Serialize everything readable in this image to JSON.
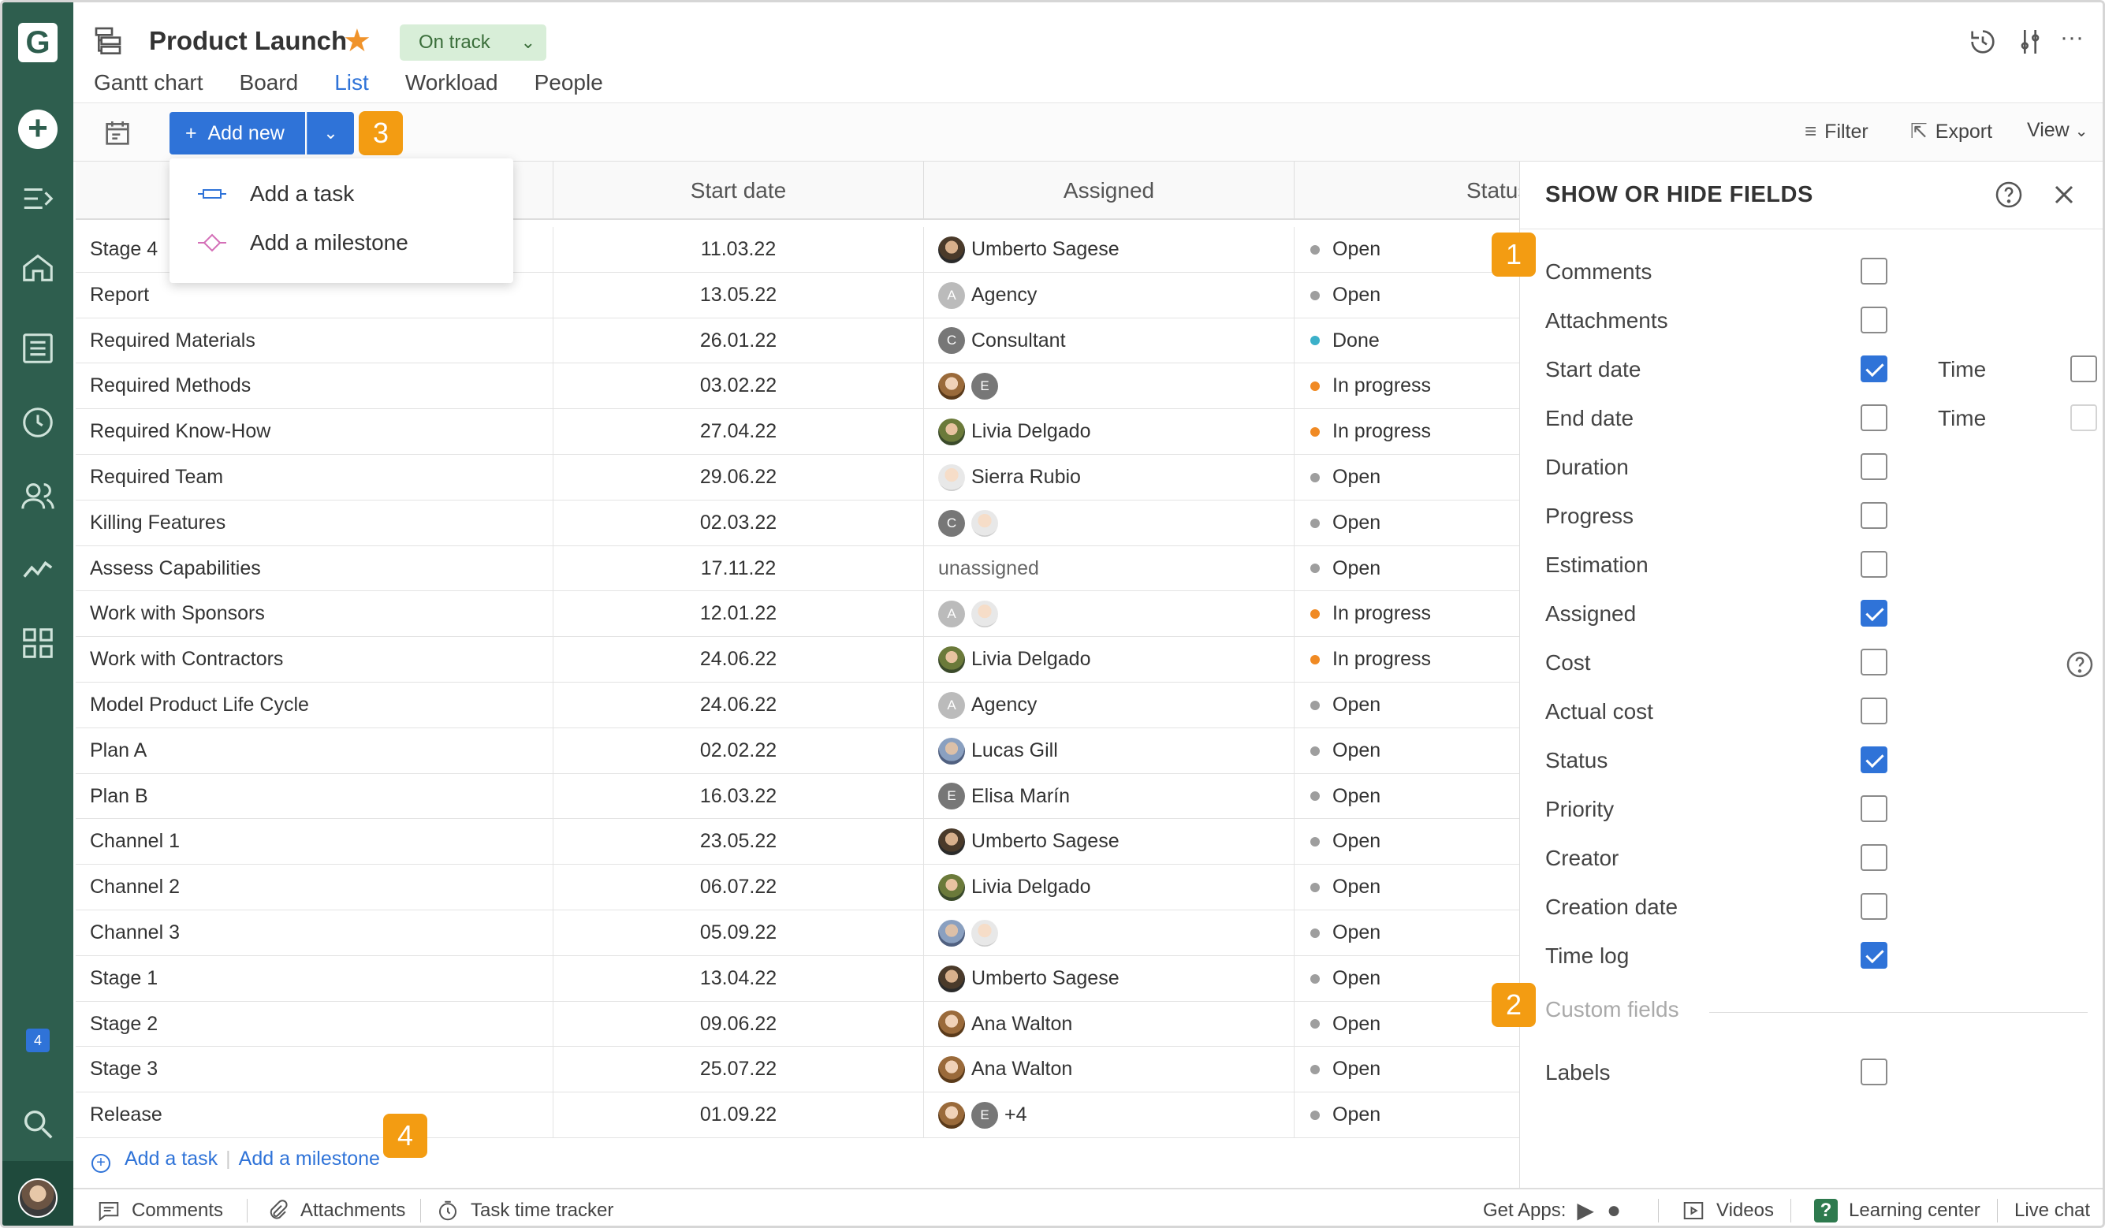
{
  "project": {
    "title": "Product Launch",
    "status_label": "On track"
  },
  "tabs": [
    {
      "label": "Gantt chart"
    },
    {
      "label": "Board"
    },
    {
      "label": "List"
    },
    {
      "label": "Workload"
    },
    {
      "label": "People"
    }
  ],
  "toolbar": {
    "add_new_label": "Add new",
    "filter_label": "Filter",
    "export_label": "Export",
    "view_label": "View"
  },
  "dropdown": {
    "items": [
      {
        "label": "Add a task"
      },
      {
        "label": "Add a milestone"
      }
    ]
  },
  "callouts": {
    "one": "1",
    "two": "2",
    "three": "3",
    "four": "4"
  },
  "table": {
    "columns": {
      "start_date": "Start date",
      "assigned": "Assigned",
      "status": "Status"
    },
    "rows": [
      {
        "name": "Stage 4",
        "date": "11.03.22",
        "assigned": "Umberto Sagese",
        "status": "Open"
      },
      {
        "name": "Report",
        "date": "13.05.22",
        "assigned": "Agency",
        "status": "Open"
      },
      {
        "name": "Required Materials",
        "date": "26.01.22",
        "assigned": "Consultant",
        "status": "Done"
      },
      {
        "name": "Required Methods",
        "date": "03.02.22",
        "assigned": "",
        "status": "In progress"
      },
      {
        "name": "Required Know-How",
        "date": "27.04.22",
        "assigned": "Livia Delgado",
        "status": "In progress"
      },
      {
        "name": "Required Team",
        "date": "29.06.22",
        "assigned": "Sierra Rubio",
        "status": "Open"
      },
      {
        "name": "Killing Features",
        "date": "02.03.22",
        "assigned": "",
        "status": "Open"
      },
      {
        "name": "Assess Capabilities",
        "date": "17.11.22",
        "assigned": "unassigned",
        "status": "Open"
      },
      {
        "name": "Work with Sponsors",
        "date": "12.01.22",
        "assigned": "",
        "status": "In progress"
      },
      {
        "name": "Work with Contractors",
        "date": "24.06.22",
        "assigned": "Livia Delgado",
        "status": "In progress"
      },
      {
        "name": "Model Product Life Cycle",
        "date": "24.06.22",
        "assigned": "Agency",
        "status": "Open"
      },
      {
        "name": "Plan A",
        "date": "02.02.22",
        "assigned": "Lucas Gill",
        "status": "Open"
      },
      {
        "name": "Plan B",
        "date": "16.03.22",
        "assigned": "Elisa Marín",
        "status": "Open"
      },
      {
        "name": "Channel 1",
        "date": "23.05.22",
        "assigned": "Umberto Sagese",
        "status": "Open"
      },
      {
        "name": "Channel 2",
        "date": "06.07.22",
        "assigned": "Livia Delgado",
        "status": "Open"
      },
      {
        "name": "Channel 3",
        "date": "05.09.22",
        "assigned": "",
        "status": "Open"
      },
      {
        "name": "Stage 1",
        "date": "13.04.22",
        "assigned": "Umberto Sagese",
        "status": "Open"
      },
      {
        "name": "Stage 2",
        "date": "09.06.22",
        "assigned": "Ana Walton",
        "status": "Open"
      },
      {
        "name": "Stage 3",
        "date": "25.07.22",
        "assigned": "Ana Walton",
        "status": "Open"
      },
      {
        "name": "Release",
        "date": "01.09.22",
        "assigned": "+4",
        "status": "Open"
      }
    ],
    "add_task_label": "Add a task",
    "add_milestone_label": "Add a milestone"
  },
  "panel": {
    "title": "SHOW OR HIDE FIELDS",
    "fields": [
      {
        "label": "Comments",
        "checked": false
      },
      {
        "label": "Attachments",
        "checked": false
      },
      {
        "label": "Start date",
        "checked": true
      },
      {
        "label": "End date",
        "checked": false
      },
      {
        "label": "Duration",
        "checked": false
      },
      {
        "label": "Progress",
        "checked": false
      },
      {
        "label": "Estimation",
        "checked": false
      },
      {
        "label": "Assigned",
        "checked": true
      },
      {
        "label": "Cost",
        "checked": false
      },
      {
        "label": "Actual cost",
        "checked": false
      },
      {
        "label": "Status",
        "checked": true
      },
      {
        "label": "Priority",
        "checked": false
      },
      {
        "label": "Creator",
        "checked": false
      },
      {
        "label": "Creation date",
        "checked": false
      },
      {
        "label": "Time log",
        "checked": true
      }
    ],
    "time_label_1": "Time",
    "time_label_2": "Time",
    "custom_fields_label": "Custom fields",
    "labels_field": "Labels"
  },
  "rail": {
    "notification_count": "4"
  },
  "footer": {
    "comments": "Comments",
    "attachments": "Attachments",
    "task_time_tracker": "Task time tracker",
    "get_apps": "Get Apps:",
    "videos": "Videos",
    "learning_center": "Learning center",
    "live_chat": "Live chat"
  },
  "colors": {
    "accent": "#2f73d8",
    "rail": "#2e5e4e",
    "callout": "#f39c12",
    "open": "#9e9e9e",
    "done": "#3bb0c9",
    "in_progress": "#f08a24"
  }
}
